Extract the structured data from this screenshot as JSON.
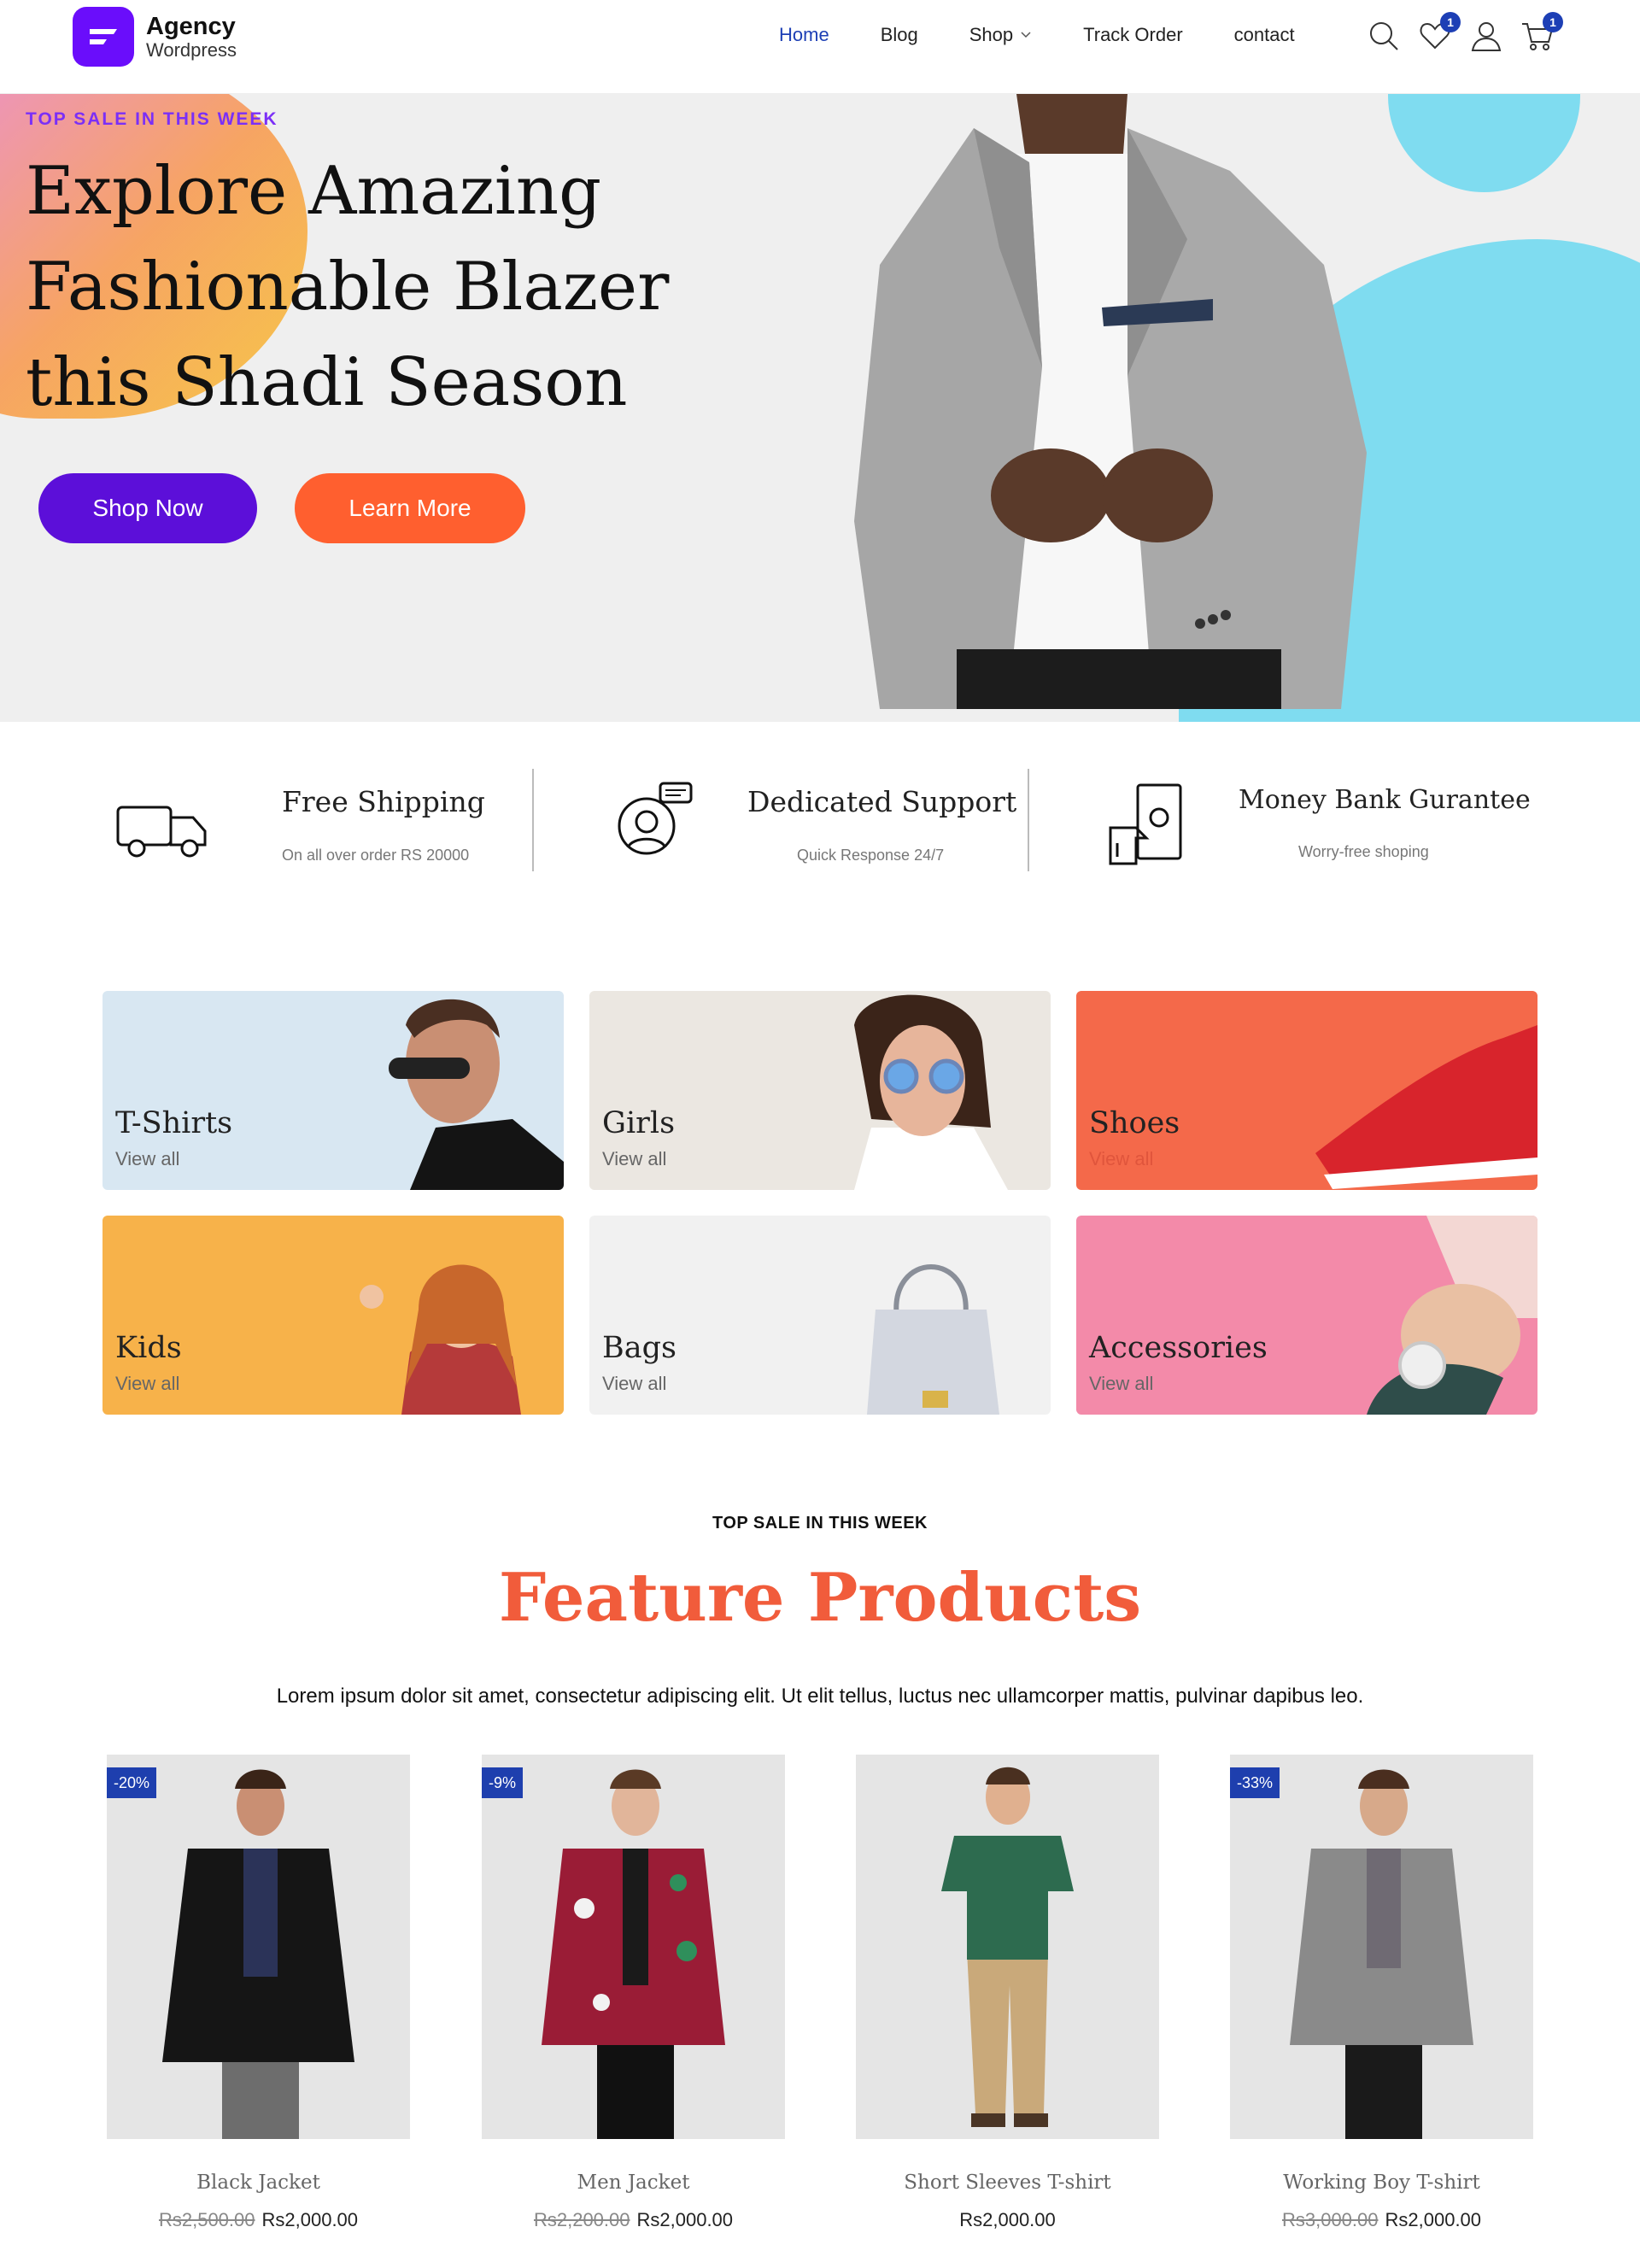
{
  "brand": {
    "name": "Agency",
    "tagline": "Wordpress",
    "accent": "#6a0dfb"
  },
  "nav": {
    "items": [
      {
        "label": "Home",
        "active": true
      },
      {
        "label": "Blog"
      },
      {
        "label": "Shop",
        "has_dropdown": true
      },
      {
        "label": "Track Order"
      },
      {
        "label": "contact"
      }
    ],
    "icons": {
      "search": "search-icon",
      "wishlist": "heart-icon",
      "wishlist_count": "1",
      "account": "user-icon",
      "cart": "cart-icon",
      "cart_count": "1"
    }
  },
  "hero": {
    "kicker": "TOP SALE IN THIS WEEK",
    "title": "Explore Amazing Fashionable Blazer this Shadi Season",
    "primary_button": "Shop Now",
    "secondary_button": "Learn More",
    "colors": {
      "primary": "#5c0fd9",
      "secondary": "#ff5f2f"
    }
  },
  "features": [
    {
      "icon": "truck-icon",
      "title": "Free Shipping",
      "subtitle": "On all over order RS 20000"
    },
    {
      "icon": "support-agent-icon",
      "title": "Dedicated Support",
      "subtitle": "Quick Response 24/7"
    },
    {
      "icon": "money-hand-icon",
      "title": "Money Bank Gurantee",
      "subtitle": "Worry-free shoping"
    }
  ],
  "categories": [
    {
      "label": "T-Shirts",
      "link": "View all",
      "bg": "#d8e7f2"
    },
    {
      "label": "Girls",
      "link": "View all",
      "bg": "#ebe7e1"
    },
    {
      "label": "Shoes",
      "link": "View all",
      "bg": "#f4694a"
    },
    {
      "label": "Kids",
      "link": "View all",
      "bg": "#f7b24a"
    },
    {
      "label": "Bags",
      "link": "View all",
      "bg": "#f1f1f1"
    },
    {
      "label": "Accessories",
      "link": "View all",
      "bg": "#f38aa9"
    }
  ],
  "featured": {
    "kicker": "TOP SALE IN THIS WEEK",
    "title": "Feature Products",
    "description": "Lorem ipsum dolor sit amet, consectetur adipiscing elit. Ut elit tellus, luctus nec ullamcorper mattis, pulvinar dapibus leo.",
    "products": [
      {
        "name": "Black Jacket",
        "old_price": "Rs2,500.00",
        "price": "Rs2,000.00",
        "discount": "-20%"
      },
      {
        "name": "Men Jacket",
        "old_price": "Rs2,200.00",
        "price": "Rs2,000.00",
        "discount": "-9%"
      },
      {
        "name": "Short Sleeves T-shirt",
        "old_price": "",
        "price": "Rs2,000.00",
        "discount": ""
      },
      {
        "name": "Working Boy T-shirt",
        "old_price": "Rs3,000.00",
        "price": "Rs2,000.00",
        "discount": "-33%"
      }
    ]
  }
}
